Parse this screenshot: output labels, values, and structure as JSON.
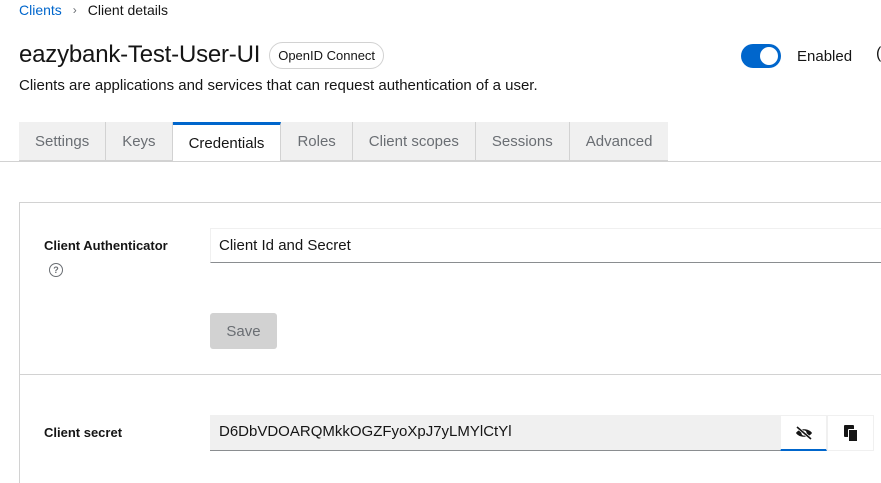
{
  "breadcrumb": {
    "parent": "Clients",
    "separator": "›",
    "current": "Client details"
  },
  "header": {
    "title": "eazybank-Test-User-UI",
    "badge": "OpenID Connect",
    "subtitle": "Clients are applications and services that can request authentication of a user.",
    "enabled_label": "Enabled",
    "enabled": true
  },
  "tabs": [
    {
      "label": "Settings",
      "active": false
    },
    {
      "label": "Keys",
      "active": false
    },
    {
      "label": "Credentials",
      "active": true
    },
    {
      "label": "Roles",
      "active": false
    },
    {
      "label": "Client scopes",
      "active": false
    },
    {
      "label": "Sessions",
      "active": false
    },
    {
      "label": "Advanced",
      "active": false
    }
  ],
  "credentials": {
    "authenticator_label": "Client Authenticator",
    "authenticator_value": "Client Id and Secret",
    "save_label": "Save",
    "secret_label": "Client secret",
    "secret_value": "D6DbVDOARQMkkOGZFyoXpJ7yLMYlCtYl"
  },
  "colors": {
    "accent": "#0066cc",
    "tab_bg": "#f0f0f0",
    "border": "#d2d2d2"
  },
  "icons": [
    "help-icon",
    "eye-slash-icon",
    "copy-icon"
  ]
}
